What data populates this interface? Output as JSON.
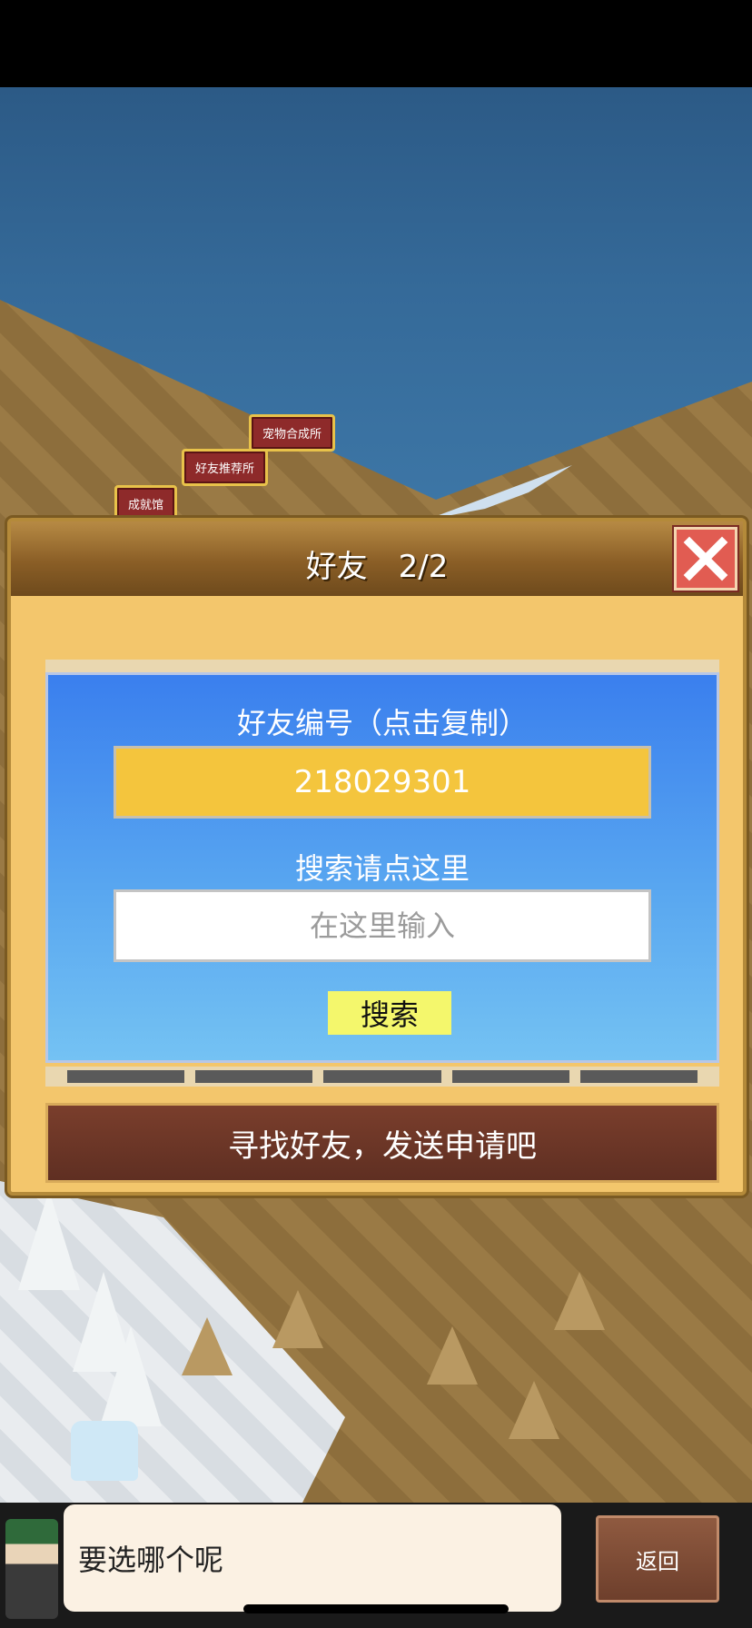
{
  "map": {
    "buildings": [
      {
        "label": "宠物合成所"
      },
      {
        "label": "好友推荐所"
      },
      {
        "label": "成就馆"
      }
    ]
  },
  "dialog": {
    "title": "好友　2/2",
    "close_icon": "close-x-icon",
    "friend_id_label": "好友编号（点击复制）",
    "friend_id_value": "218029301",
    "search_label": "搜索请点这里",
    "search_placeholder": "在这里输入",
    "search_button": "搜索",
    "find_banner": "寻找好友，发送申请吧"
  },
  "bottom": {
    "prompt": "要选哪个呢",
    "back_button": "返回"
  },
  "colors": {
    "panel_blue": "#3a7fee",
    "id_field_yellow": "#f4c53d",
    "search_button_yellow": "#f4f76c",
    "close_red": "#e15c52",
    "banner_brown": "#6e3a28"
  }
}
